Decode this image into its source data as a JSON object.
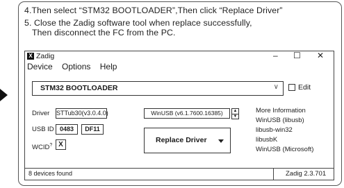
{
  "instructions": {
    "line1": "4.Then select “STM32 BOOTLOADER”,Then click “Replace Driver”",
    "line2": "5. Close the Zadig software tool when replace successfully,",
    "line3": "Then disconnect the FC from the PC."
  },
  "window": {
    "icon_text": "X",
    "title": "Zadig",
    "minimize": "–",
    "maximize": "☐",
    "close": "✕"
  },
  "menu": {
    "device": "Device",
    "options": "Options",
    "help": "Help"
  },
  "device": {
    "selected": "STM32 BOOTLOADER",
    "chevron": "∨",
    "edit_label": "Edit"
  },
  "driver": {
    "label": "Driver",
    "current": "STTub30(v3.0.4.0)",
    "target": "WinUSB (v6.1.7600.16385)"
  },
  "usb": {
    "label": "USB ID",
    "vid": "0483",
    "pid": "DF11"
  },
  "wcid": {
    "label": "WCID",
    "sup": "?",
    "value": "X"
  },
  "replace_button": {
    "label": "Replace Driver"
  },
  "info_links": [
    "More Information",
    "WinUSB (libusb)",
    "libusb-win32",
    "libusbK",
    "WinUSB (Microsoft)"
  ],
  "status": {
    "left": "8 devices found",
    "right": "Zadig 2.3.701"
  }
}
